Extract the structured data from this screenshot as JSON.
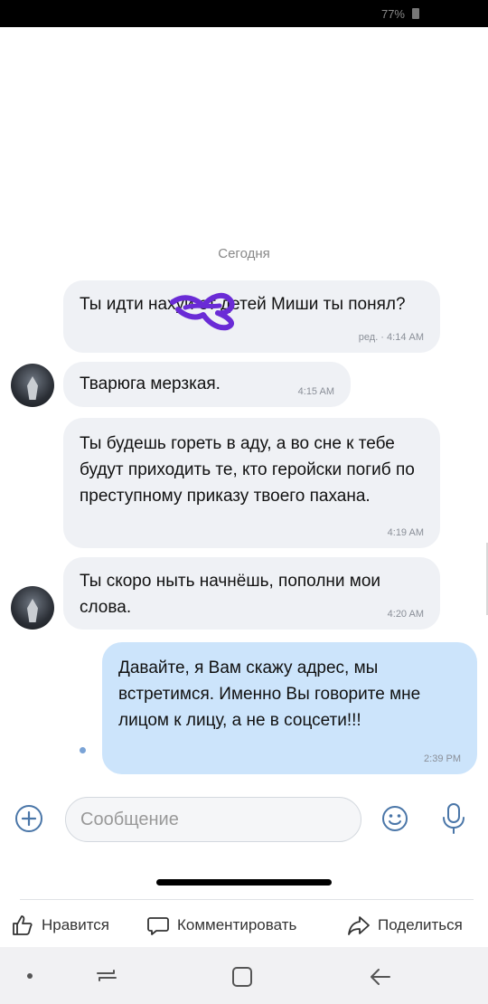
{
  "status_bar": {
    "battery_percent": "77%"
  },
  "chat": {
    "date_separator": "Сегодня",
    "messages": [
      {
        "direction": "out",
        "text": "Ты идти нахуй от детей Миши ты понял?",
        "meta": "ред. · 4:14 AM"
      },
      {
        "direction": "in",
        "text": "Тварюга мерзкая.",
        "time": "4:15 AM"
      },
      {
        "direction": "out",
        "text": "Ты будешь гореть в аду, а во сне к тебе будут приходить те, кто геройски погиб по преступному приказу твоего пахана.",
        "time": "4:19 AM"
      },
      {
        "direction": "in",
        "text": "Ты скоро ныть начнёшь, пополни мои слова.",
        "time": "4:20 AM"
      },
      {
        "direction": "out",
        "text": "Давайте, я Вам скажу адрес, мы встретимся. Именно Вы говорите мне лицом к лицу, а не в соцсети!!!",
        "time": "2:39 PM"
      }
    ]
  },
  "composer": {
    "placeholder": "Сообщение"
  },
  "post_actions": {
    "like": "Нравится",
    "comment": "Комментировать",
    "share": "Поделиться"
  },
  "icons": [
    "plus-circle-icon",
    "emoji-icon",
    "microphone-icon",
    "thumbs-up-icon",
    "comment-icon",
    "share-icon",
    "recent-apps-icon",
    "home-icon",
    "back-icon"
  ]
}
